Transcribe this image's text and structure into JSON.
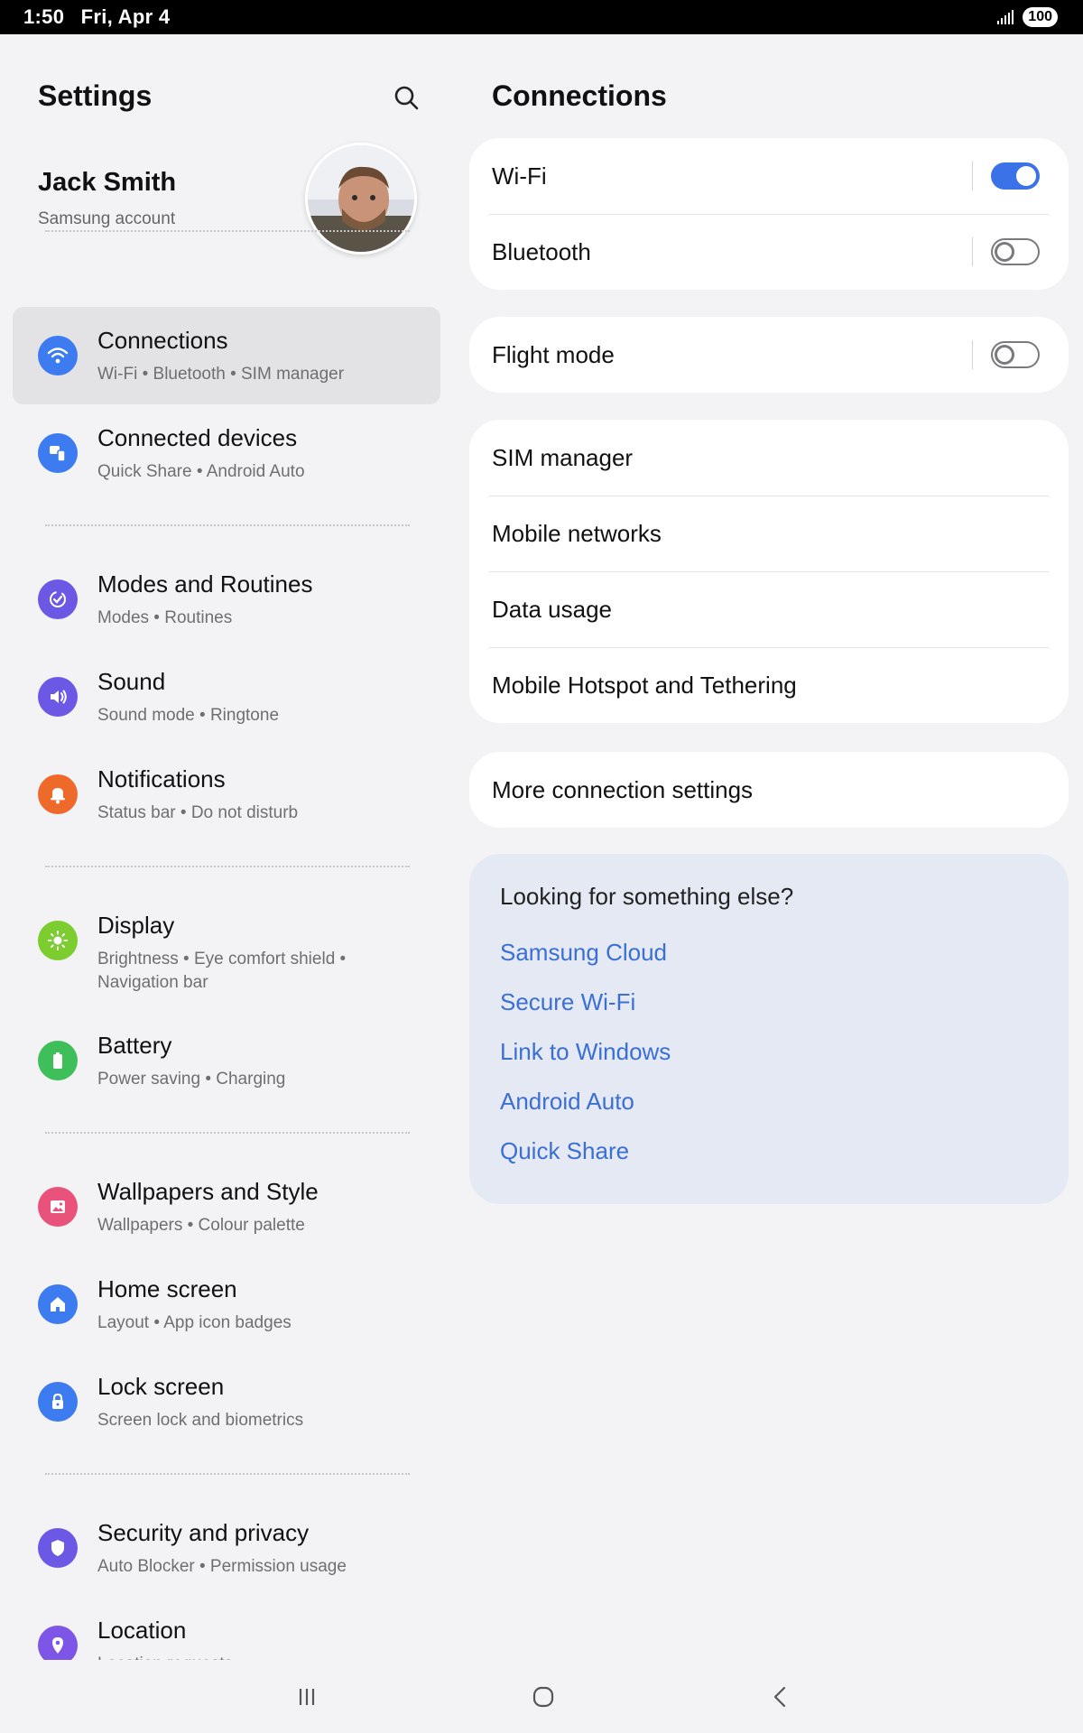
{
  "status_bar": {
    "time": "1:50",
    "date": "Fri, Apr 4",
    "battery": "100"
  },
  "left": {
    "title": "Settings",
    "profile": {
      "name": "Jack Smith",
      "subtitle": "Samsung account"
    },
    "items": [
      {
        "title": "Connections",
        "subtitle": "Wi-Fi  •  Bluetooth  •  SIM manager",
        "icon": "wifi-icon",
        "color": "#3d7bf0"
      },
      {
        "title": "Connected devices",
        "subtitle": "Quick Share  •  Android Auto",
        "icon": "devices-icon",
        "color": "#3d7bf0"
      },
      {
        "title": "Modes and Routines",
        "subtitle": "Modes  •  Routines",
        "icon": "routines-icon",
        "color": "#6b59e6"
      },
      {
        "title": "Sound",
        "subtitle": "Sound mode  •  Ringtone",
        "icon": "speaker-icon",
        "color": "#6b59e6"
      },
      {
        "title": "Notifications",
        "subtitle": "Status bar  •  Do not disturb",
        "icon": "bell-icon",
        "color": "#ee6a2a"
      },
      {
        "title": "Display",
        "subtitle": "Brightness  •  Eye comfort shield  •  Navigation bar",
        "icon": "sun-icon",
        "color": "#7ccd2f"
      },
      {
        "title": "Battery",
        "subtitle": "Power saving  •  Charging",
        "icon": "battery-icon",
        "color": "#3fbf5a"
      },
      {
        "title": "Wallpapers and Style",
        "subtitle": "Wallpapers  •  Colour palette",
        "icon": "image-icon",
        "color": "#e9527b"
      },
      {
        "title": "Home screen",
        "subtitle": "Layout  •  App icon badges",
        "icon": "home-icon",
        "color": "#3d7bf0"
      },
      {
        "title": "Lock screen",
        "subtitle": "Screen lock and biometrics",
        "icon": "lock-icon",
        "color": "#3d7bf0"
      },
      {
        "title": "Security and privacy",
        "subtitle": "Auto Blocker  •  Permission usage",
        "icon": "shield-icon",
        "color": "#6b59e6"
      },
      {
        "title": "Location",
        "subtitle": "Location requests",
        "icon": "location-pin-icon",
        "color": "#7d56e8"
      }
    ]
  },
  "right": {
    "title": "Connections",
    "wifi": {
      "label": "Wi-Fi",
      "state": "on"
    },
    "bluetooth": {
      "label": "Bluetooth",
      "state": "off"
    },
    "flight": {
      "label": "Flight mode",
      "state": "off"
    },
    "sim_manager": "SIM manager",
    "mobile_networks": "Mobile networks",
    "data_usage": "Data usage",
    "hotspot": "Mobile Hotspot and Tethering",
    "more": "More connection settings",
    "suggest": {
      "title": "Looking for something else?",
      "links": [
        "Samsung Cloud",
        "Secure Wi-Fi",
        "Link to Windows",
        "Android Auto",
        "Quick Share"
      ]
    }
  }
}
